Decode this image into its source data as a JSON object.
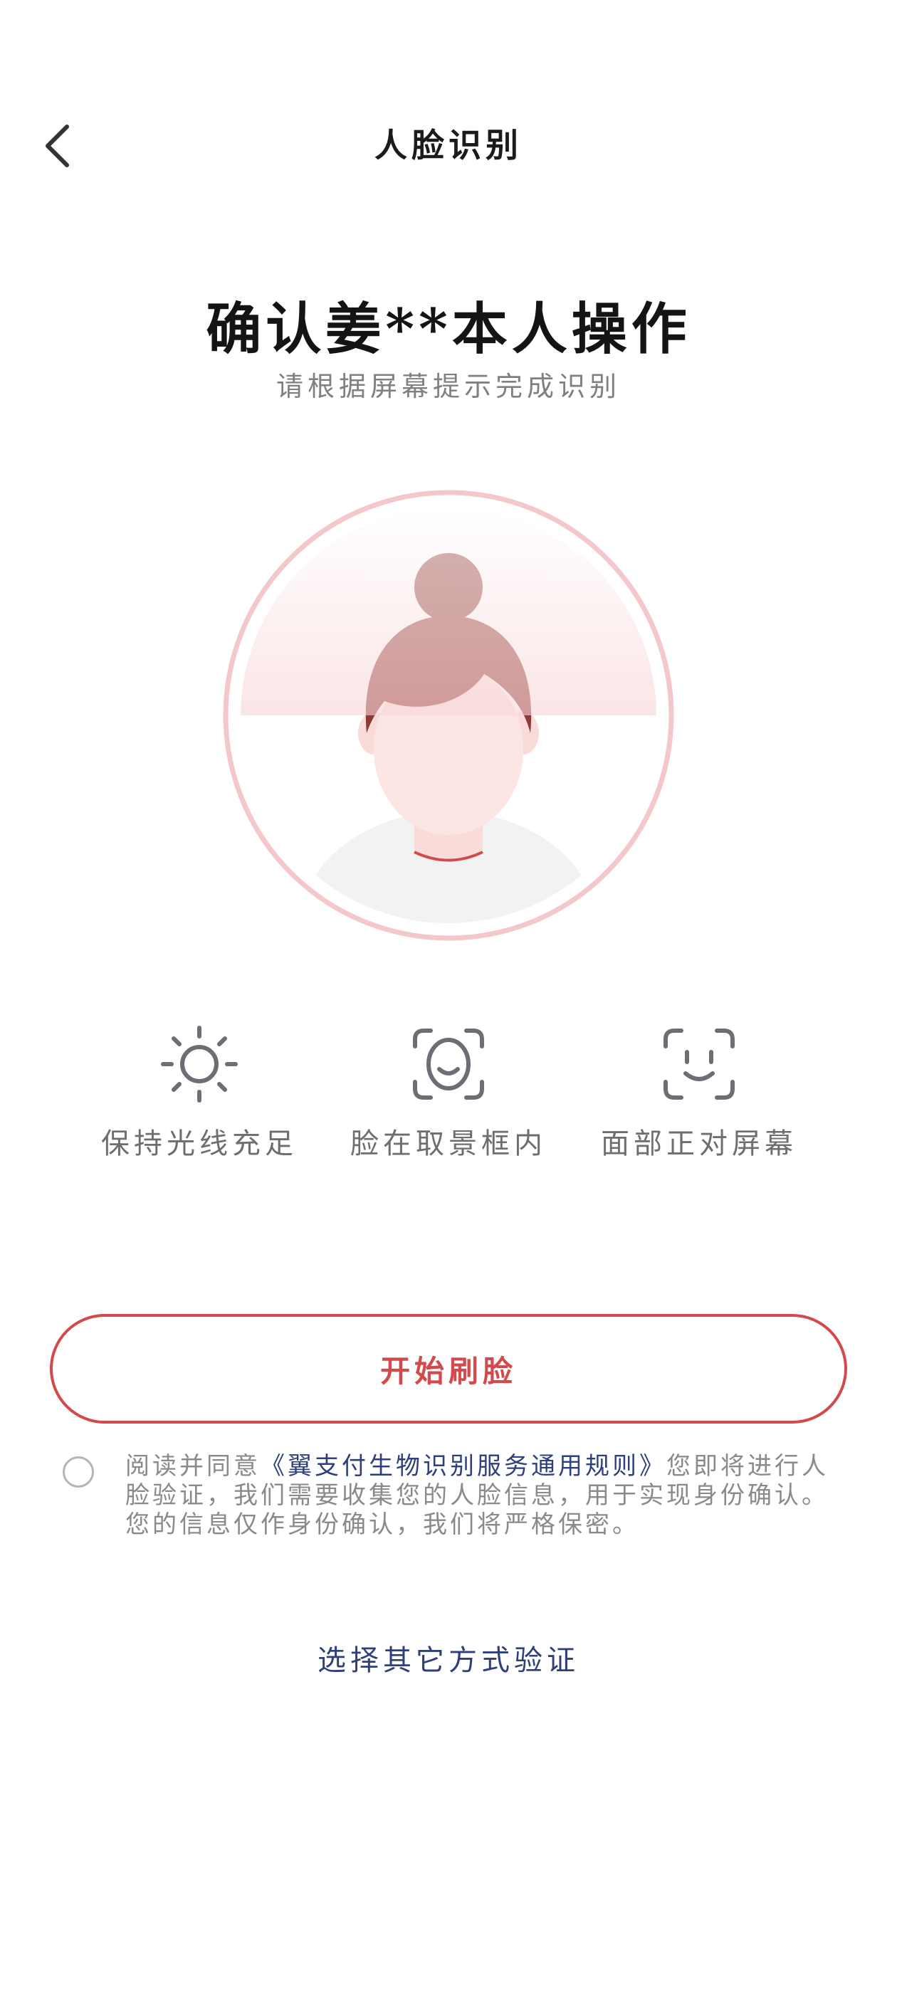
{
  "header": {
    "back_icon": "chevron-left-icon",
    "title": "人脸识别"
  },
  "main": {
    "title": "确认姜**本人操作",
    "subtitle": "请根据屏幕提示完成识别"
  },
  "illustration": {
    "icon": "face-avatar-illustration",
    "accent_color": "#e8969a",
    "hair_color": "#8f3b35"
  },
  "tips": [
    {
      "icon": "sun-icon",
      "label": "保持光线充足"
    },
    {
      "icon": "face-in-frame-icon",
      "label": "脸在取景框内"
    },
    {
      "icon": "face-front-icon",
      "label": "面部正对屏幕"
    }
  ],
  "actions": {
    "start_label": "开始刷脸",
    "alt_verify_label": "选择其它方式验证"
  },
  "agreement": {
    "checked": false,
    "prefix": "阅读并同意",
    "link_text": "《翼支付生物识别服务通用规则》",
    "suffix": "您即将进行人脸验证，我们需要收集您的人脸信息，用于实现身份确认。您的信息仅作身份确认，我们将严格保密。"
  },
  "colors": {
    "brand_red": "#d24a4c",
    "link_blue": "#2e3f7c",
    "icon_gray": "#6b6e75"
  }
}
